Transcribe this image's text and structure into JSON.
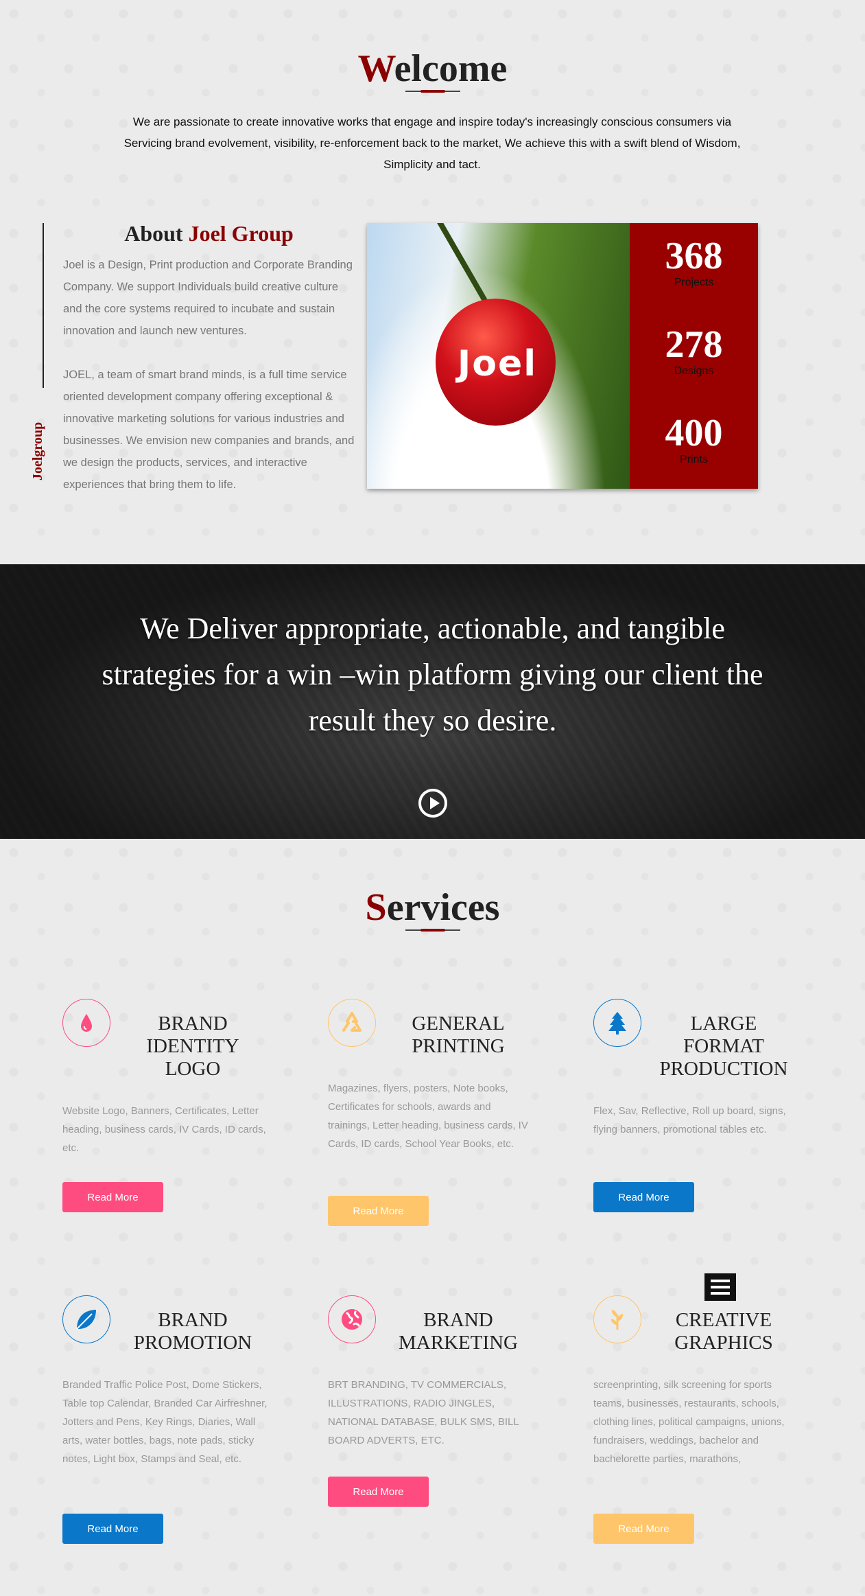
{
  "welcome": {
    "title_first": "W",
    "title_rest": "elcome",
    "text": "We are passionate to create innovative works that engage and inspire today's increasingly conscious consumers via Servicing brand evolvement, visibility, re-enforcement back to the market, We achieve this with a swift blend of Wisdom, Simplicity and tact."
  },
  "about": {
    "vertical_label": "Joelgroup",
    "title_prefix": "About ",
    "title_accent": "Joel Group",
    "p1": "Joel is a Design, Print production and Corporate Branding Company. We support Individuals build creative culture and the core systems required to incubate and sustain innovation and launch new ventures.",
    "p2": "JOEL, a team of smart brand minds, is a full time service oriented development company offering exceptional & innovative marketing solutions for various industries and businesses. We envision new companies and brands, and we design the products, services, and interactive experiences that bring them to life.",
    "image_label": "Joel",
    "stats": [
      {
        "num": "368",
        "label": "Projects"
      },
      {
        "num": "278",
        "label": "Designs"
      },
      {
        "num": "400",
        "label": "Prints"
      }
    ]
  },
  "banner": {
    "text": "We Deliver appropriate, actionable, and tangible strategies for a win –win platform giving our client the result they so desire.",
    "play_icon": "play-circle-icon"
  },
  "services": {
    "title_first": "S",
    "title_rest": "ervices",
    "items": [
      {
        "title": "BRAND IDENTITY LOGO",
        "icon": "drop-icon",
        "desc": "Website Logo, Banners, Certificates, Letter heading, business cards, IV Cards, ID cards, etc.",
        "button": "Read More",
        "color": "#ff4c80"
      },
      {
        "title": "GENERAL PRINTING",
        "icon": "recycle-icon",
        "desc": "Magazines, flyers, posters, Note books, Certificates for schools, awards and trainings, Letter heading, business cards, IV Cards, ID cards, School Year Books, etc.",
        "button": "Read More",
        "color": "#ffc56b"
      },
      {
        "title": "LARGE FORMAT PRODUCTION",
        "icon": "tree-icon",
        "desc": "Flex, Sav, Reflective, Roll up board, signs, flying banners, promotional tables etc.",
        "button": "Read More",
        "color": "#0a77c9"
      },
      {
        "title": "BRAND PROMOTION",
        "icon": "leaf-icon",
        "desc": "Branded Traffic Police Post, Dome Stickers, Table top Calendar, Branded Car Airfreshner, Jotters and Pens, Key Rings, Diaries, Wall arts, water bottles, bags, note pads, sticky notes, Light box, Stamps and Seal, etc.",
        "button": "Read More",
        "color": "#0a77c9"
      },
      {
        "title": "BRAND MARKETING",
        "icon": "globe-icon",
        "desc": "BRT BRANDING, TV COMMERCIALS, ILLUSTRATIONS, RADIO JINGLES, NATIONAL DATABASE, BULK SMS, BILL BOARD ADVERTS, ETC.",
        "button": "Read More",
        "color": "#ff4c80"
      },
      {
        "title": "CREATIVE GRAPHICS",
        "icon": "sprout-icon",
        "desc": "screenprinting, silk screening for sports teams, businesses, restaurants, schools, clothing lines, political campaigns, unions, fundraisers, weddings, bachelor and bachelorette parties, marathons,",
        "button": "Read More",
        "color": "#ffc56b"
      }
    ]
  },
  "menu_icon": "hamburger-menu-icon"
}
